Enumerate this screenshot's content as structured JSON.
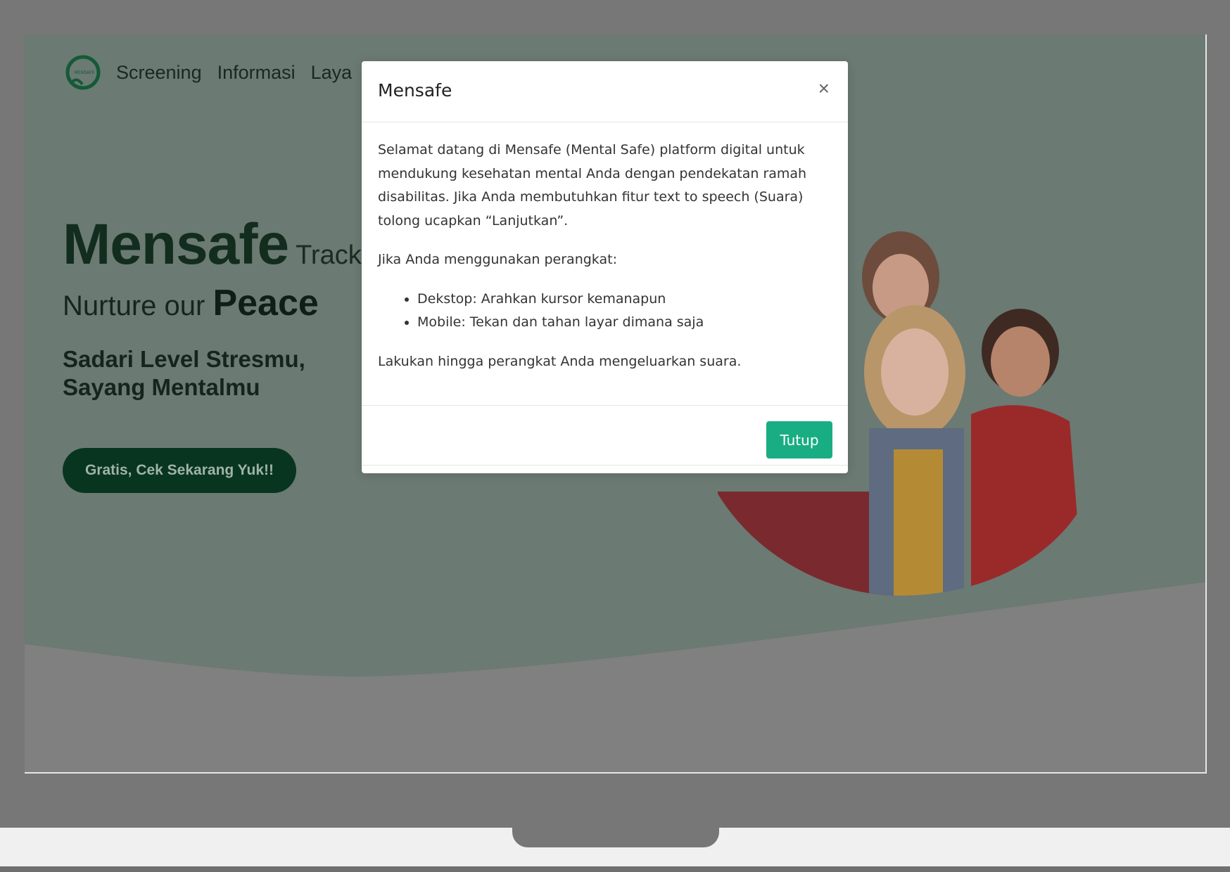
{
  "nav": {
    "items": [
      "Screening",
      "Informasi",
      "Laya"
    ]
  },
  "hero": {
    "brand": "Mensafe",
    "brand_tail": "Track",
    "line2_prefix": "Nurture our",
    "line2_strong": "Peace",
    "subtitle": "Sadari Level Stresmu, Sayang Mentalmu",
    "cta_label": "Gratis, Cek Sekarang Yuk!!"
  },
  "modal": {
    "title": "Mensafe",
    "close_symbol": "×",
    "intro": "Selamat datang di Mensafe (Mental Safe) platform digital untuk mendukung kesehatan mental Anda dengan pendekatan ramah disabilitas. Jika Anda membutuhkan fitur text to speech (Suara) tolong ucapkan “Lanjutkan”.",
    "device_heading": "Jika Anda menggunakan perangkat:",
    "devices": [
      "Dekstop: Arahkan kursor kemanapun",
      "Mobile: Tekan dan tahan layar dimana saja"
    ],
    "closing": "Lakukan hingga perangkat Anda mengeluarkan suara.",
    "button_label": "Tutup"
  },
  "colors": {
    "overlay_bg": "#6b7a73",
    "accent": "#19ad83",
    "brand_dark": "#08351f"
  }
}
